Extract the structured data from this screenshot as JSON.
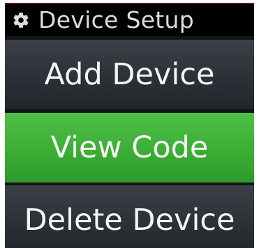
{
  "header": {
    "icon": "gear-icon",
    "title": "Device Setup"
  },
  "menu": {
    "items": [
      {
        "label": "Add Device",
        "selected": false
      },
      {
        "label": "View Code",
        "selected": true
      },
      {
        "label": "Delete Device",
        "selected": false
      }
    ]
  },
  "colors": {
    "background": "#000000",
    "header_text": "#dcdcdc",
    "item_normal": "#2c3137",
    "item_selected": "#3aae35",
    "item_text": "#f4f4f4"
  }
}
